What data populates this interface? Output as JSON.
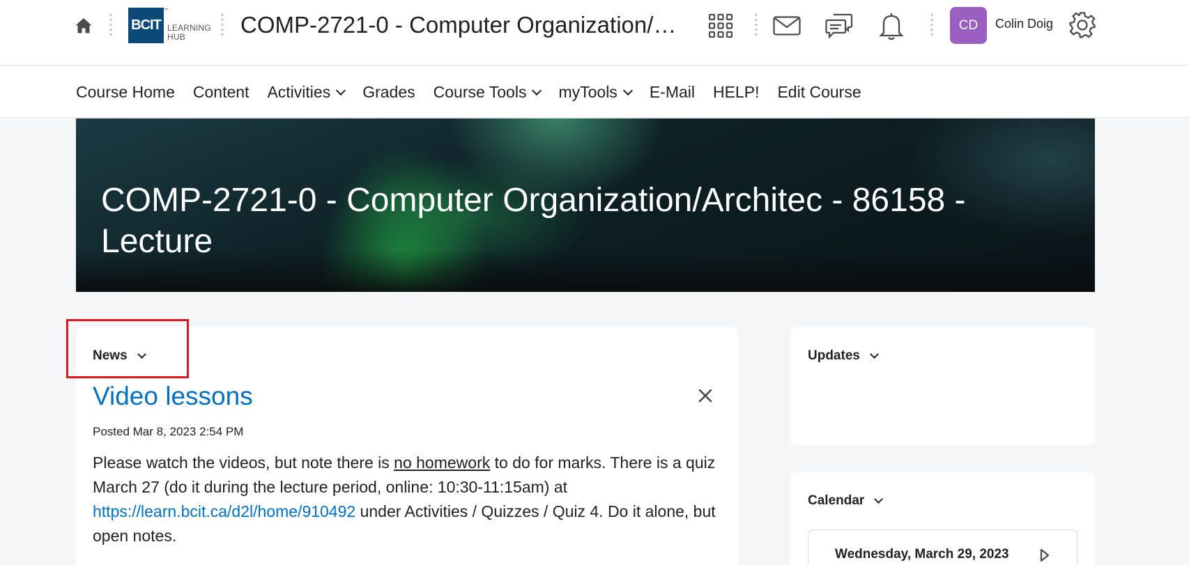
{
  "topbar": {
    "logo_mark": "BCIT",
    "logo_tm": "™",
    "logo_line1": "LEARNING",
    "logo_line2": "HUB",
    "course_title": "COMP-2721-0 - Computer Organization/Architec - 86158 - Lecture",
    "user_initials": "CD",
    "user_name": "Colin Doig",
    "avatar_color": "#9a5fc1",
    "icons": [
      "home-icon",
      "app-grid-icon",
      "mail-icon",
      "chat-icon",
      "bell-icon",
      "gear-icon"
    ]
  },
  "nav": {
    "items": [
      {
        "label": "Course Home",
        "dropdown": false
      },
      {
        "label": "Content",
        "dropdown": false
      },
      {
        "label": "Activities",
        "dropdown": true
      },
      {
        "label": "Grades",
        "dropdown": false
      },
      {
        "label": "Course Tools",
        "dropdown": true
      },
      {
        "label": "myTools",
        "dropdown": true
      },
      {
        "label": "E-Mail",
        "dropdown": false
      },
      {
        "label": "HELP!",
        "dropdown": false
      },
      {
        "label": "Edit Course",
        "dropdown": false
      }
    ]
  },
  "banner": {
    "title": "COMP-2721-0 - Computer Organization/Architec - 86158 - Lecture"
  },
  "news": {
    "heading": "News",
    "item_title": "Video lessons",
    "posted": "Posted Mar 8, 2023 2:54 PM",
    "body_1": "Please watch the videos, but note there is ",
    "body_underline": "no homework",
    "body_2": " to do for marks. There is a quiz March 27 (do it during the lecture period, online: 10:30-11:15am) at ",
    "body_link": "https://learn.bcit.ca/d2l/home/910492",
    "body_3": " under Activities / Quizzes / Quiz 4. Do it alone, but open notes."
  },
  "updates": {
    "heading": "Updates"
  },
  "calendar": {
    "heading": "Calendar",
    "date": "Wednesday, March 29, 2023"
  },
  "colors": {
    "link": "#006fbf",
    "highlight_border": "#e0141a",
    "logo_blue": "#0b4a78"
  }
}
